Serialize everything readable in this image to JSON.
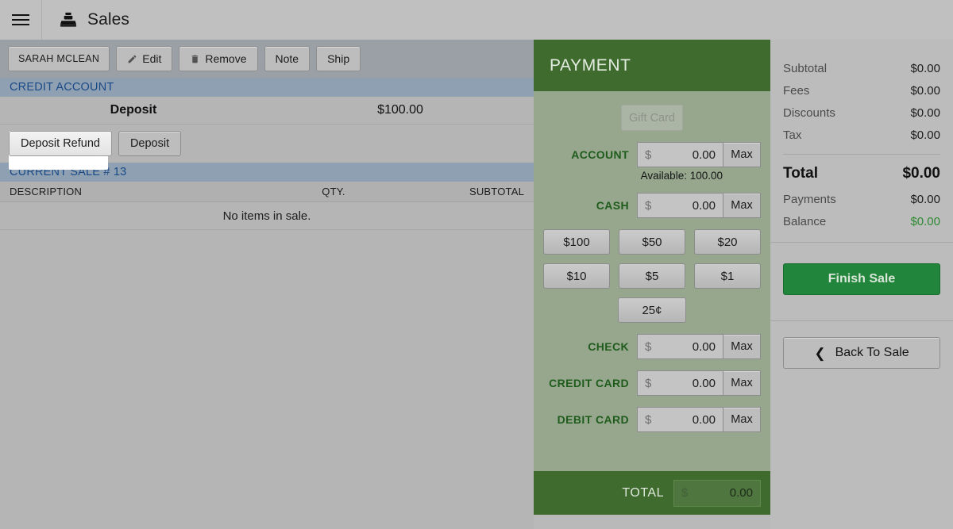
{
  "topbar": {
    "menu_icon": "hamburger-menu-icon",
    "app_icon": "cash-register-icon",
    "title": "Sales"
  },
  "toolbar": {
    "buttons": [
      {
        "label": "SARAH MCLEAN",
        "icon": null
      },
      {
        "label": "Edit",
        "icon": "pencil-icon"
      },
      {
        "label": "Remove",
        "icon": "trash-icon"
      },
      {
        "label": "Note",
        "icon": null
      },
      {
        "label": "Ship",
        "icon": null
      }
    ]
  },
  "credit_account": {
    "section_title": "CREDIT ACCOUNT",
    "deposit_label": "Deposit",
    "deposit_amount": "$100.00",
    "buttons": [
      {
        "label": "Deposit Refund",
        "focused": true
      },
      {
        "label": "Deposit",
        "focused": false
      }
    ]
  },
  "current_sale": {
    "section_title": "CURRENT SALE # 13",
    "columns": [
      "DESCRIPTION",
      "QTY.",
      "SUBTOTAL"
    ],
    "empty_message": "No items in sale."
  },
  "payment": {
    "header_title": "PAYMENT",
    "gift_card_label": "Gift Card",
    "rows": [
      {
        "label": "ACCOUNT",
        "dollar": "$",
        "value": "0.00",
        "max_label": "Max",
        "note": "Available: 100.00"
      },
      {
        "label": "CASH",
        "dollar": "$",
        "value": "0.00",
        "max_label": "Max",
        "note": null
      },
      {
        "label": "CHECK",
        "dollar": "$",
        "value": "0.00",
        "max_label": "Max",
        "note": null
      },
      {
        "label": "CREDIT CARD",
        "dollar": "$",
        "value": "0.00",
        "max_label": "Max",
        "note": null
      },
      {
        "label": "DEBIT CARD",
        "dollar": "$",
        "value": "0.00",
        "max_label": "Max",
        "note": null
      }
    ],
    "denominations": [
      "$100",
      "$50",
      "$20",
      "$10",
      "$5",
      "$1"
    ],
    "denomination_last": "25¢",
    "total_label": "TOTAL",
    "total_dollar": "$",
    "total_value": "0.00"
  },
  "sidebar": {
    "lines": [
      {
        "key": "Subtotal",
        "value": "$0.00"
      },
      {
        "key": "Fees",
        "value": "$0.00"
      },
      {
        "key": "Discounts",
        "value": "$0.00"
      },
      {
        "key": "Tax",
        "value": "$0.00"
      }
    ],
    "total": {
      "key": "Total",
      "value": "$0.00"
    },
    "payments": {
      "key": "Payments",
      "value": "$0.00"
    },
    "balance": {
      "key": "Balance",
      "value": "$0.00"
    },
    "finish_sale_label": "Finish Sale",
    "back_to_sale_label": "Back To Sale",
    "back_chevron": "chevron-left-icon"
  },
  "colors": {
    "payment_header_green": "#3f6b2e",
    "payment_body_green": "#96a78e",
    "section_header_blue": "#8fa0b3",
    "section_header_text": "#1a4a86",
    "finish_sale_green": "#21853b",
    "balance_green": "#2e8b32",
    "toolbar_gray": "#9ba0a6",
    "content_gray": "#b5b5b5",
    "sidebar_gray": "#bcbcbc",
    "topbar_gray": "#c0c0c0"
  }
}
